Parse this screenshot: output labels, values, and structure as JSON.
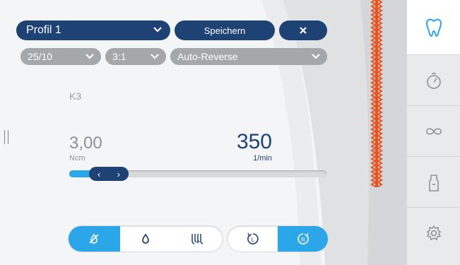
{
  "colors": {
    "navy": "#1e4273",
    "accent_blue": "#2ba6e8",
    "gray_select": "#a5a8ab",
    "file_orange": "#e8541f"
  },
  "profile": {
    "label": "Profil 1",
    "icon": "chevron-down-icon"
  },
  "toolbar": {
    "save_label": "Speichern",
    "close_icon": "close-icon"
  },
  "settings": {
    "ratio": "25/10",
    "gear": "3:1",
    "mode": "Auto-Reverse"
  },
  "file_name": "K3",
  "torque": {
    "value": "3,00",
    "unit": "Ncm"
  },
  "speed": {
    "value": "350",
    "unit": "1/min"
  },
  "slider": {
    "left_arrow": "‹",
    "right_arrow": "›",
    "level": 0.12
  },
  "toggles_left": [
    {
      "icon": "spray-off-icon",
      "active": true
    },
    {
      "icon": "drop-icon",
      "active": false
    },
    {
      "icon": "apex-icon",
      "active": false
    }
  ],
  "toggles_right": [
    {
      "icon": "rotation-left-icon",
      "letter": "L",
      "active": false
    },
    {
      "icon": "rotation-right-icon",
      "letter": "R",
      "active": true
    }
  ],
  "sidebar": [
    {
      "icon": "tooth-icon",
      "active": true
    },
    {
      "icon": "timer-icon",
      "active": false
    },
    {
      "icon": "infinity-loop-icon",
      "active": false
    },
    {
      "icon": "spray-bottle-icon",
      "active": false
    },
    {
      "icon": "gear-icon",
      "active": false
    }
  ]
}
